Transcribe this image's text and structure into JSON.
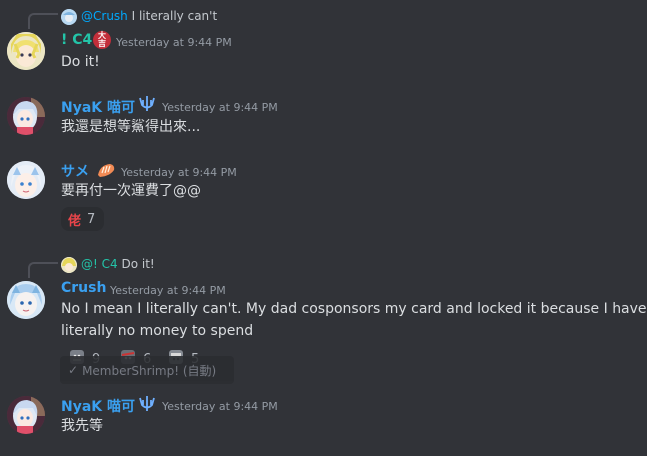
{
  "colors": {
    "background": "#313338",
    "mention": "#00a8fc",
    "c4_name": "#23c4a8",
    "nyak_name": "#3aa0f0",
    "same_name": "#3aa0f0",
    "crush_name": "#3aa0f0",
    "timestamp": "#949ba4",
    "message": "#dbdee1"
  },
  "messages": [
    {
      "reply": {
        "avatar_icon": "crush-avatar-icon",
        "mention": "@Crush",
        "text": "I literally can't"
      },
      "author": "! C4",
      "badge_icon": "daikichi-icon",
      "timestamp": "Yesterday at 9:44 PM",
      "content": "Do it!"
    },
    {
      "author": "NyaK 喵可",
      "badge_icon": "trident-icon",
      "timestamp": "Yesterday at 9:44 PM",
      "content": "我還是想等鯊得出來..."
    },
    {
      "author": "サメ",
      "badge_icon": "shrimp-icon",
      "timestamp": "Yesterday at 9:44 PM",
      "content": "要再付一次運費了@@",
      "reactions": [
        {
          "emoji_icon": "lao-character-icon",
          "count": "7"
        }
      ]
    },
    {
      "reply": {
        "avatar_icon": "c4-avatar-icon",
        "mention": "@! C4",
        "text": "Do it!"
      },
      "author": "Crush",
      "timestamp": "Yesterday at 9:44 PM",
      "content_lines": [
        "No I mean I literally can't. My dad cosponsors my card and locked it because I have",
        "literally no money to spend"
      ],
      "reactions": [
        {
          "emoji_icon": "character-emoji-1-icon",
          "count": "9"
        },
        {
          "emoji_icon": "character-emoji-2-icon",
          "count": "6"
        },
        {
          "emoji_icon": "character-emoji-3-icon",
          "count": "5"
        }
      ]
    },
    {
      "author": "NyaK 喵可",
      "badge_icon": "trident-icon",
      "timestamp": "Yesterday at 9:44 PM",
      "content": "我先等"
    }
  ],
  "tooltip": {
    "icon": "check-icon",
    "label": "MemberShrimp! (自動)"
  }
}
